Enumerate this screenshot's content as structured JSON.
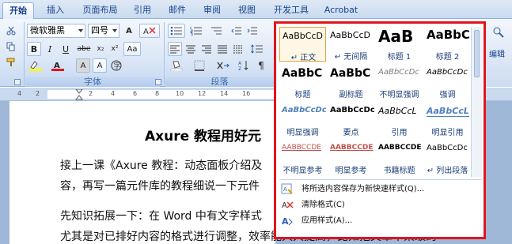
{
  "tabs": [
    {
      "label": "开始",
      "active": true
    },
    {
      "label": "插入"
    },
    {
      "label": "页面布局"
    },
    {
      "label": "引用"
    },
    {
      "label": "邮件"
    },
    {
      "label": "审阅"
    },
    {
      "label": "视图"
    },
    {
      "label": "开发工具"
    },
    {
      "label": "Acrobat"
    }
  ],
  "ribbon": {
    "font_name": "微软雅黑",
    "font_size": "四号",
    "font_group_label": "字体",
    "paragraph_group_label": "段落",
    "bold": "B",
    "italic": "I",
    "underline": "U",
    "strike": "abe",
    "subscript": "x₂",
    "superscript": "x²",
    "wen": "wén",
    "A_label": "A",
    "Aa_label": "Aa",
    "right_partial": "编辑"
  },
  "ruler": {
    "numbers": [
      "4",
      "2",
      "2",
      "4",
      "6",
      "8",
      "10",
      "12",
      "14",
      "16"
    ]
  },
  "document": {
    "title": "Axure 教程用好元",
    "lines": [
      "接上一课《Axure 教程：动态面板介绍及",
      "容，再写一篇元件库的教程细说一下元件",
      "先知识拓展一下：在 Word 中有文字样式",
      "尤其是对已排好内容的格式进行调整，效率能大大提高，比如把文章中某级的"
    ]
  },
  "gallery": {
    "styles": [
      {
        "sample": "AaBbCcD",
        "label": "↵ 正文",
        "selected": true
      },
      {
        "sample": "AaBbCcD",
        "label": "↵ 无间隔"
      },
      {
        "sample": "AaB",
        "label": "标题 1"
      },
      {
        "sample": "AaBbC",
        "label": "标题 2"
      },
      {
        "sample": "AaBbC",
        "label": "标题"
      },
      {
        "sample": "AaBbC",
        "label": "副标题"
      },
      {
        "sample": "AaBbCcDc",
        "label": "不明显强调"
      },
      {
        "sample": "AaBbCcDc",
        "label": "强调"
      },
      {
        "sample": "AaBbCcDc",
        "label": "明显强调"
      },
      {
        "sample": "AaBbCcDc",
        "label": "要点"
      },
      {
        "sample": "AaBbCcL",
        "label": "引用"
      },
      {
        "sample": "AaBbCcL",
        "label": "明显引用"
      },
      {
        "sample": "AABBCCDE",
        "label": "不明显参考"
      },
      {
        "sample": "AABBCCDE",
        "label": "明显参考"
      },
      {
        "sample": "AABBCCDE",
        "label": "书籍标题"
      },
      {
        "sample": "AaBbCcDc",
        "label": "↵ 列出段落"
      }
    ],
    "menu": [
      {
        "label": "将所选内容保存为新快速样式(Q)..."
      },
      {
        "label": "清除格式(C)"
      },
      {
        "label": "应用样式(A)..."
      }
    ]
  }
}
